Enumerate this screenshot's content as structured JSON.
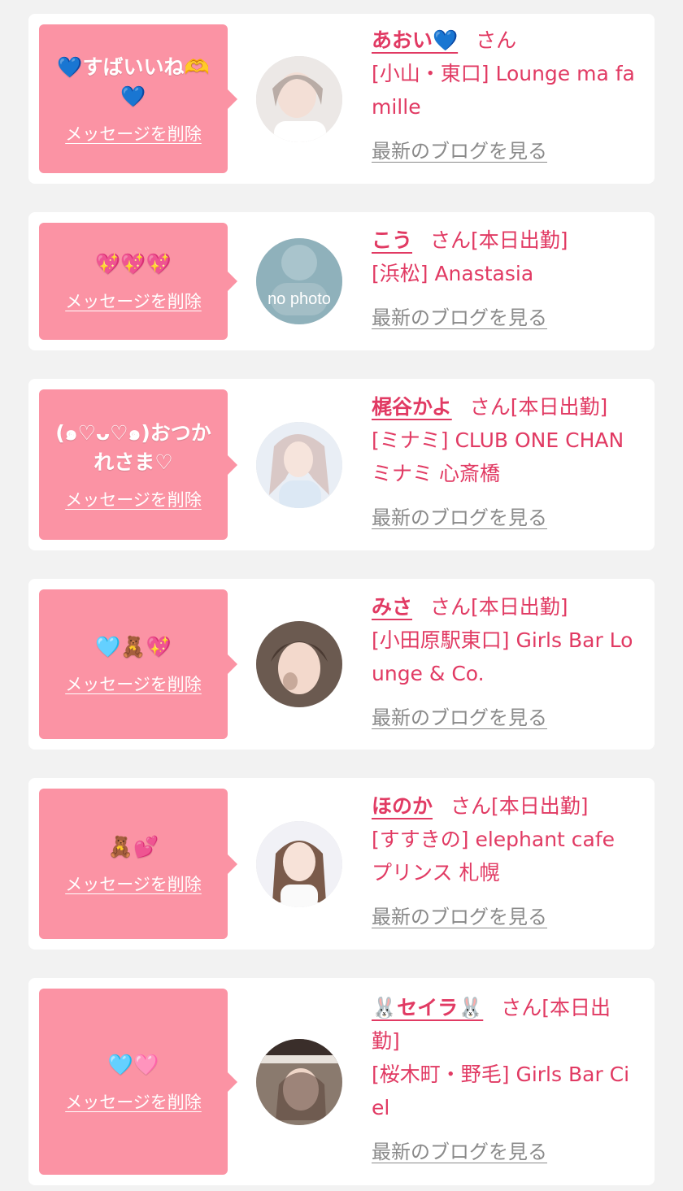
{
  "delete_label": "メッセージを削除",
  "blog_label": "最新のブログを見る",
  "colors": {
    "bubble": "#fb93a4",
    "accent": "#e13a63",
    "link_gray": "#8a8a8a",
    "background": "#f2f2f2"
  },
  "items": [
    {
      "message": "💙すばいいね🫶💙",
      "name": "あおい💙",
      "suffix": "さん",
      "shop": "[小山・東口] Lounge ma famille",
      "avatar": "photo"
    },
    {
      "message": "💖💖💖",
      "name": "こう",
      "suffix": "さん[本日出勤]",
      "shop": "[浜松] Anastasia",
      "avatar": "no photo"
    },
    {
      "message": "(๑♡ᴗ♡๑)おつかれさま♡",
      "name": "梶谷かよ",
      "suffix": "さん[本日出勤]",
      "shop": "[ミナミ] CLUB ONE CHAN ミナミ 心斎橋",
      "avatar": "photo"
    },
    {
      "message": "🩵🧸💖",
      "name": "みさ",
      "suffix": "さん[本日出勤]",
      "shop": "[小田原駅東口] Girls Bar Lounge & Co.",
      "avatar": "photo"
    },
    {
      "message": "🧸💕",
      "name": "ほのか",
      "suffix": "さん[本日出勤]",
      "shop": "[すすきの] elephant cafe プリンス 札幌",
      "avatar": "photo"
    },
    {
      "message": "🩵🩷",
      "name": "🐰セイラ🐰",
      "suffix": "さん[本日出勤]",
      "shop": "[桜木町・野毛] Girls Bar Ciel",
      "avatar": "photo"
    }
  ]
}
